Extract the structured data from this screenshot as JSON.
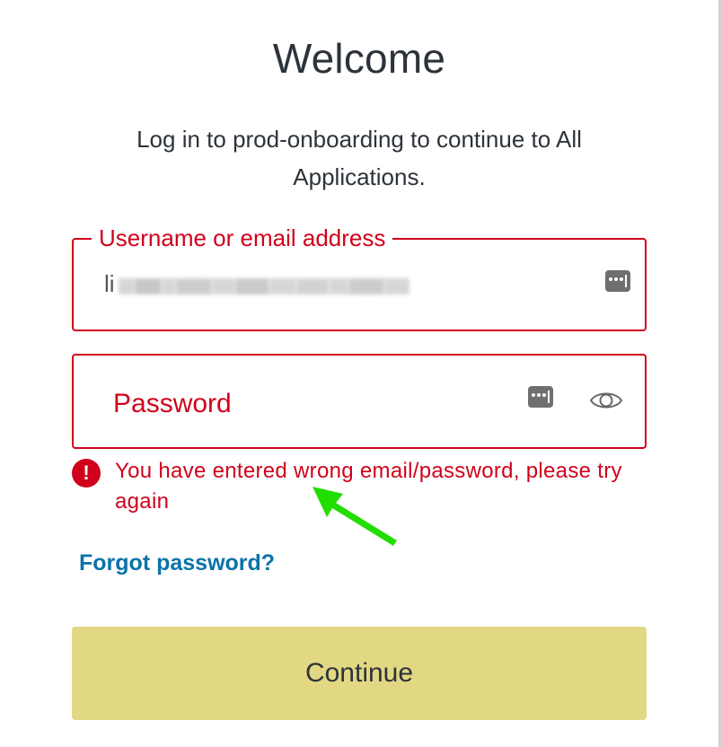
{
  "header": {
    "title": "Welcome",
    "subtitle": "Log in to prod-onboarding to continue to All Applications."
  },
  "username": {
    "label": "Username or email address",
    "value_visible_prefix": "li",
    "value_redacted": true,
    "autofill_icon": "password-manager-key-icon"
  },
  "password": {
    "placeholder": "Password",
    "autofill_icon": "password-manager-key-icon",
    "toggle_icon": "eye-icon"
  },
  "error": {
    "icon": "exclamation-circle-icon",
    "message": "You have entered wrong email/password, please try again"
  },
  "annotation": {
    "icon": "arrow-icon",
    "color": "#22dd00"
  },
  "links": {
    "forgot_password": "Forgot password?"
  },
  "actions": {
    "continue_label": "Continue"
  },
  "colors": {
    "error": "#d0021b",
    "link": "#0b73a8",
    "primary_button": "#e2d884",
    "text": "#2d333a"
  }
}
